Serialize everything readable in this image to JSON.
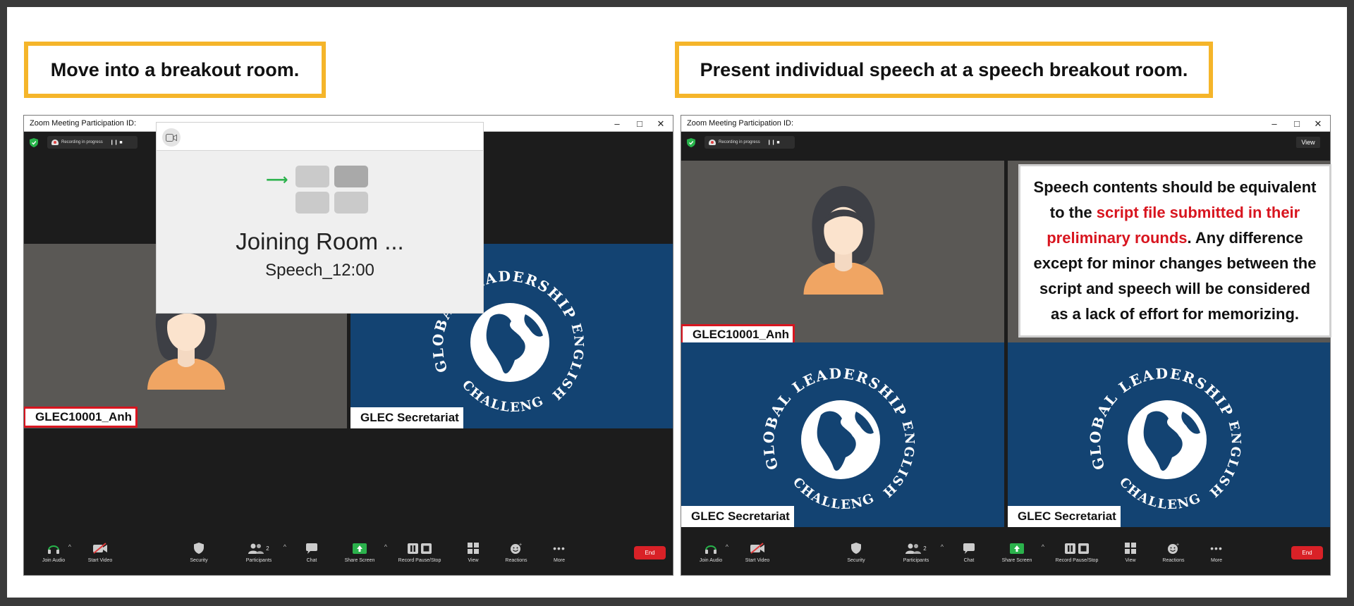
{
  "callouts": {
    "left": "Move into a breakout room.",
    "right": "Present individual speech at a speech breakout room."
  },
  "window": {
    "title": "Zoom Meeting Participation ID:",
    "controls": [
      "–",
      "□",
      "✕"
    ],
    "recording_text": "Recording in progress",
    "recording_controls": "❙❙  ■",
    "view_label": "View"
  },
  "dialog": {
    "title": "Joining Room ...",
    "subtitle": "Speech_12:00"
  },
  "participants": {
    "student": "GLEC10001_Anh",
    "host": "GLEC Secretariat"
  },
  "note": {
    "part1": "Speech contents should be equivalent to the ",
    "highlight": "script file submitted in their preliminary rounds",
    "part2": ". Any difference except for minor changes between the script and speech will be considered as a lack of effort for memorizing."
  },
  "logo": {
    "top_text": "GLOBAL LEADERSHIP",
    "side_text": "ENGLISH",
    "bottom_text": "CHALLENGE"
  },
  "toolbar": {
    "join_audio": "Join Audio",
    "start_video": "Start Video",
    "security": "Security",
    "participants": "Participants",
    "participant_count": "2",
    "chat": "Chat",
    "share_screen": "Share Screen",
    "record": "Record Pause/Stop",
    "view": "View",
    "reactions": "Reactions",
    "more": "More",
    "end": "End"
  },
  "colors": {
    "callout_border": "#f5b52a",
    "tile_blue": "#134372",
    "tile_gray": "#5a5855",
    "highlight_red": "#d8151f",
    "share_green": "#2bb24c",
    "end_red": "#d92127"
  },
  "icons": [
    "shield-icon",
    "recording-cloud-icon",
    "camera-icon",
    "headphones-icon",
    "video-off-icon",
    "security-shield-icon",
    "participants-icon",
    "chat-icon",
    "share-screen-icon",
    "record-icon",
    "view-grid-icon",
    "reactions-icon",
    "more-icon",
    "arrow-right-icon"
  ]
}
